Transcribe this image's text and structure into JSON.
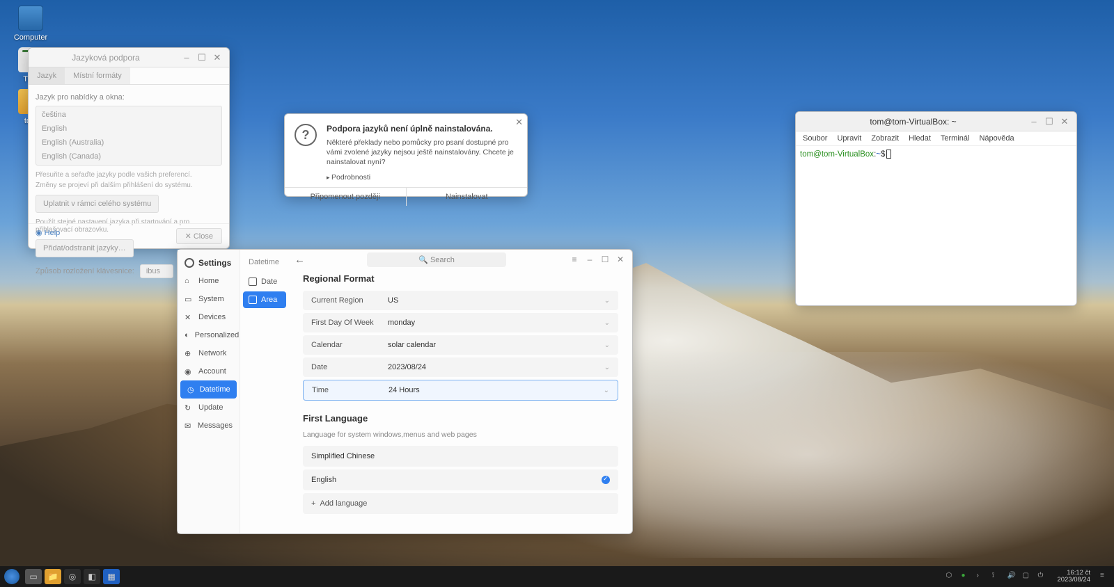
{
  "desktop": {
    "computer": "Computer",
    "trash": "Tras",
    "tom": "tom"
  },
  "langWindow": {
    "title": "Jazyková podpora",
    "tabs": {
      "lang": "Jazyk",
      "regional": "Místní formáty"
    },
    "menuLabel": "Jazyk pro nabídky a okna:",
    "items": [
      "čeština",
      "English",
      "English (Australia)",
      "English (Canada)"
    ],
    "dragNote": "Přesuňte a seřaďte jazyky podle vašich preferencí.",
    "effectNote": "Změny se projeví při dalším přihlášení do systému.",
    "applyBtn": "Uplatnit v rámci celého systému",
    "sameNote": "Použít stejné nastavení jazyka při startování a pro přihlašovací obrazovku.",
    "addRemove": "Přidat/odstranit jazyky…",
    "kbMethod": "Způsob rozložení klávesnice:",
    "kbValue": "ibus",
    "help": "Help",
    "close": "✕ Close"
  },
  "dialog": {
    "title": "Podpora jazyků není úplně nainstalována.",
    "text": "Některé překlady nebo pomůcky pro psaní dostupné pro vámi zvolené jazyky nejsou ještě nainstalovány. Chcete je nainstalovat nyní?",
    "details": "Podrobnosti",
    "later": "Připomenout později",
    "install": "Nainstalovat"
  },
  "settings": {
    "header": "Settings",
    "nav": {
      "home": "Home",
      "system": "System",
      "devices": "Devices",
      "personalized": "Personalized",
      "network": "Network",
      "account": "Account",
      "datetime": "Datetime",
      "update": "Update",
      "messages": "Messages"
    },
    "sub": {
      "header": "Datetime",
      "date": "Date",
      "area": "Area"
    },
    "search": "Search",
    "regional": {
      "title": "Regional Format",
      "currentRegion": {
        "lbl": "Current Region",
        "val": "US"
      },
      "firstDay": {
        "lbl": "First Day Of Week",
        "val": "monday"
      },
      "calendar": {
        "lbl": "Calendar",
        "val": "solar calendar"
      },
      "date": {
        "lbl": "Date",
        "val": "2023/08/24"
      },
      "time": {
        "lbl": "Time",
        "val": "24 Hours"
      }
    },
    "firstLang": {
      "title": "First Language",
      "sub": "Language for system windows,menus and web pages",
      "zh": "Simplified Chinese",
      "en": "English",
      "add": "Add language"
    }
  },
  "terminal": {
    "title": "tom@tom-VirtualBox: ~",
    "menu": [
      "Soubor",
      "Upravit",
      "Zobrazit",
      "Hledat",
      "Terminál",
      "Nápověda"
    ],
    "promptUser": "tom@tom-VirtualBox",
    "promptPath": "~",
    "promptSep": ":",
    "promptEnd": "$"
  },
  "taskbar": {
    "time": "16:12 čt",
    "date": "2023/08/24"
  }
}
